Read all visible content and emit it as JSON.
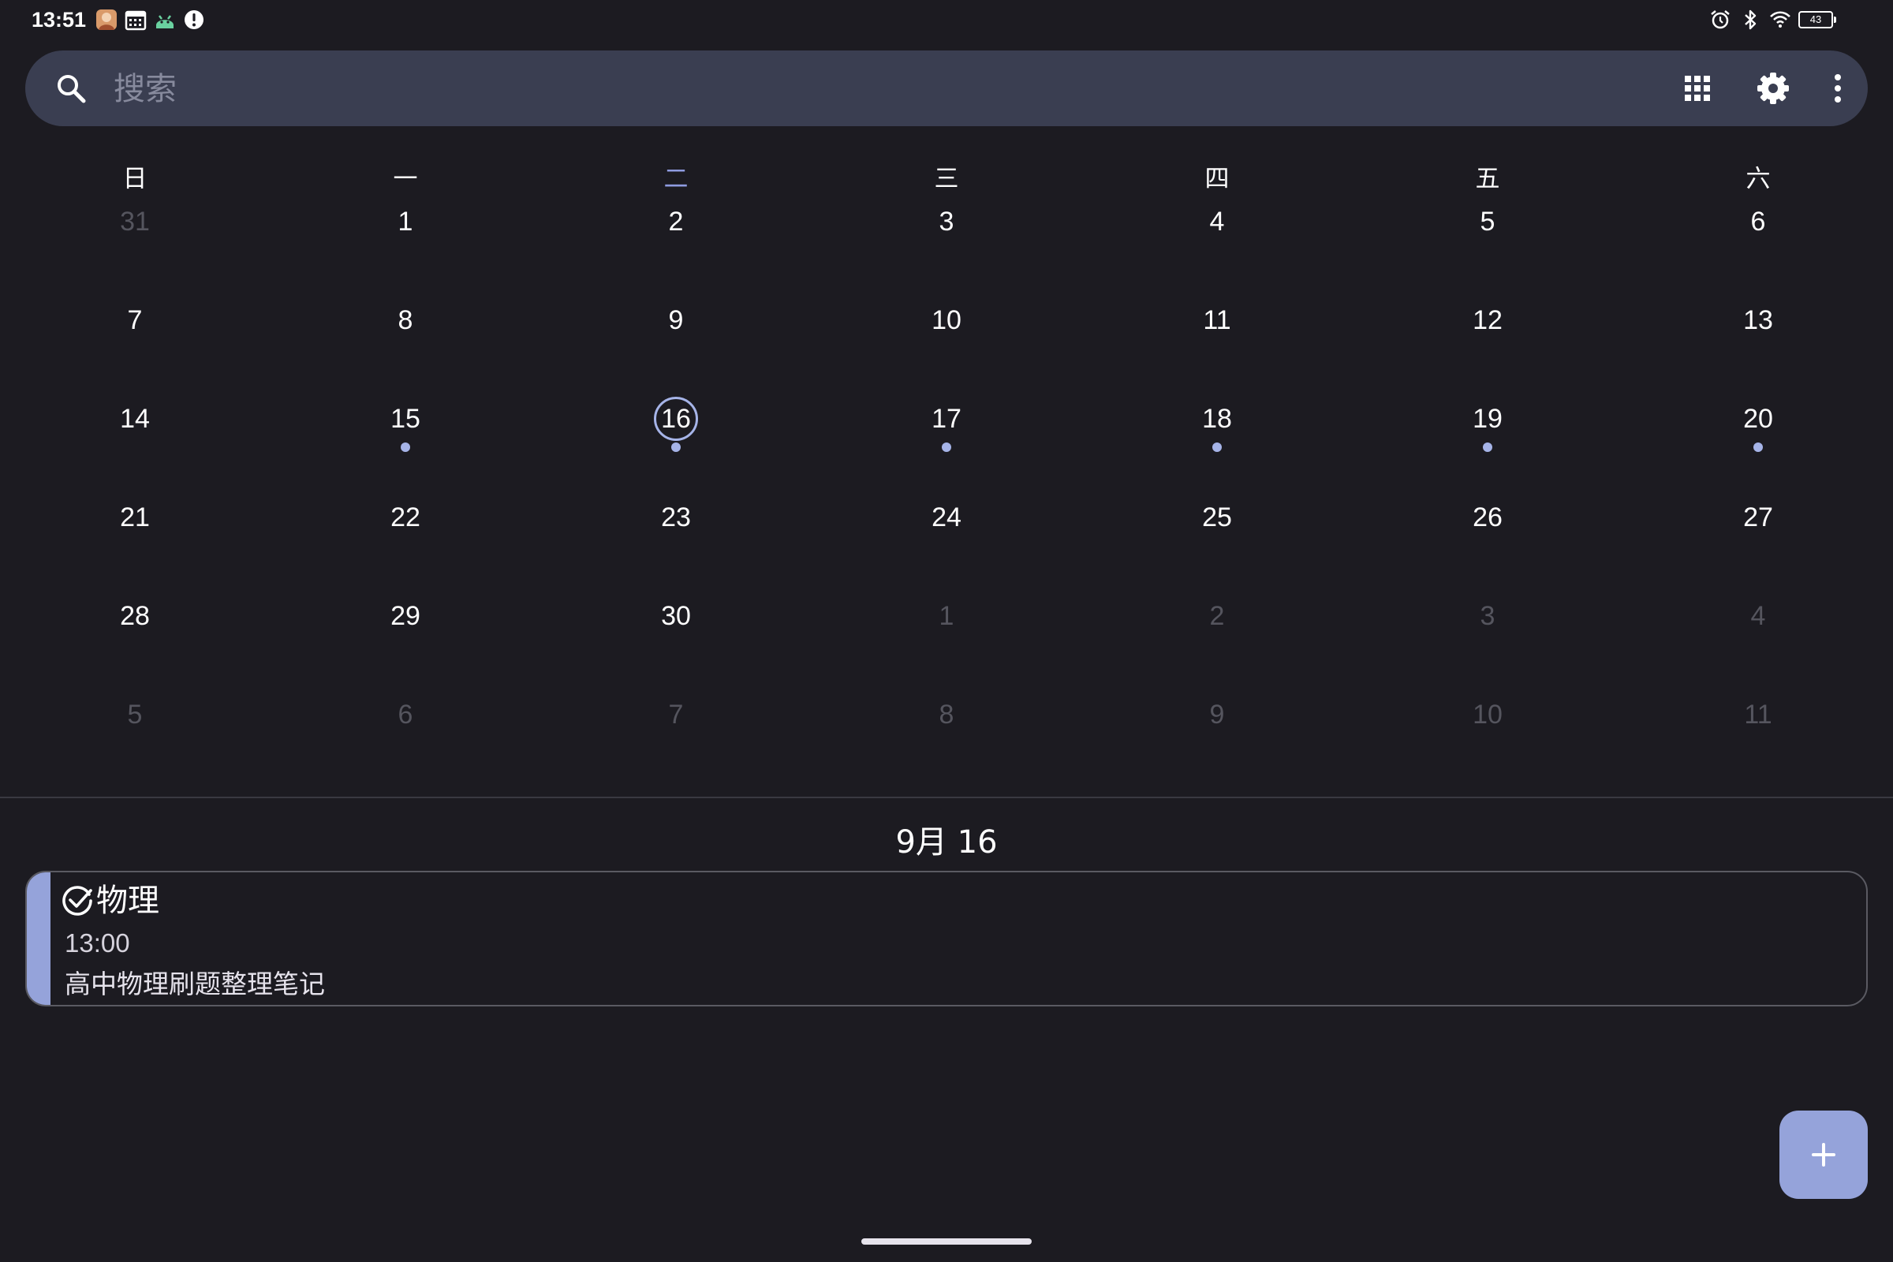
{
  "status_bar": {
    "time": "13:51",
    "left_icons": [
      "avatar-notification-icon",
      "calendar-notification-icon",
      "android-notification-icon",
      "alert-notification-icon"
    ],
    "right_icons": [
      "alarm-icon",
      "bluetooth-icon",
      "wifi-icon",
      "battery-icon"
    ],
    "battery_level": "43"
  },
  "search": {
    "placeholder": "搜索",
    "value": ""
  },
  "toolbar": {
    "icons": [
      "grid-view-icon",
      "settings-gear-icon",
      "more-vertical-icon"
    ]
  },
  "calendar": {
    "weekdays": [
      "日",
      "一",
      "二",
      "三",
      "四",
      "五",
      "六"
    ],
    "today_column_index": 2,
    "weeks": [
      [
        {
          "day": "31",
          "current": false
        },
        {
          "day": "1",
          "current": true
        },
        {
          "day": "2",
          "current": true
        },
        {
          "day": "3",
          "current": true
        },
        {
          "day": "4",
          "current": true
        },
        {
          "day": "5",
          "current": true
        },
        {
          "day": "6",
          "current": true
        }
      ],
      [
        {
          "day": "7",
          "current": true
        },
        {
          "day": "8",
          "current": true
        },
        {
          "day": "9",
          "current": true
        },
        {
          "day": "10",
          "current": true
        },
        {
          "day": "11",
          "current": true
        },
        {
          "day": "12",
          "current": true
        },
        {
          "day": "13",
          "current": true
        }
      ],
      [
        {
          "day": "14",
          "current": true
        },
        {
          "day": "15",
          "current": true,
          "event": true
        },
        {
          "day": "16",
          "current": true,
          "event": true,
          "selected": true
        },
        {
          "day": "17",
          "current": true,
          "event": true
        },
        {
          "day": "18",
          "current": true,
          "event": true
        },
        {
          "day": "19",
          "current": true,
          "event": true
        },
        {
          "day": "20",
          "current": true,
          "event": true
        }
      ],
      [
        {
          "day": "21",
          "current": true
        },
        {
          "day": "22",
          "current": true
        },
        {
          "day": "23",
          "current": true
        },
        {
          "day": "24",
          "current": true
        },
        {
          "day": "25",
          "current": true
        },
        {
          "day": "26",
          "current": true
        },
        {
          "day": "27",
          "current": true
        }
      ],
      [
        {
          "day": "28",
          "current": true
        },
        {
          "day": "29",
          "current": true
        },
        {
          "day": "30",
          "current": true
        },
        {
          "day": "1",
          "current": false
        },
        {
          "day": "2",
          "current": false
        },
        {
          "day": "3",
          "current": false
        },
        {
          "day": "4",
          "current": false
        }
      ],
      [
        {
          "day": "5",
          "current": false
        },
        {
          "day": "6",
          "current": false
        },
        {
          "day": "7",
          "current": false
        },
        {
          "day": "8",
          "current": false
        },
        {
          "day": "9",
          "current": false
        },
        {
          "day": "10",
          "current": false
        },
        {
          "day": "11",
          "current": false
        }
      ]
    ]
  },
  "agenda": {
    "date_heading": "9月 16",
    "events": [
      {
        "icon": "check-circle-icon",
        "title": "物理",
        "time": "13:00",
        "description": "高中物理刷题整理笔记",
        "color": "#95a3da"
      }
    ]
  },
  "fab": {
    "label": "+",
    "icon": "plus-icon"
  },
  "colors": {
    "background": "#1c1b21",
    "search_bar": "#3a3e51",
    "accent": "#95a3da",
    "today_header": "#8e9be0",
    "event_dot": "#a6b4e8",
    "muted_text": "#55555e"
  }
}
